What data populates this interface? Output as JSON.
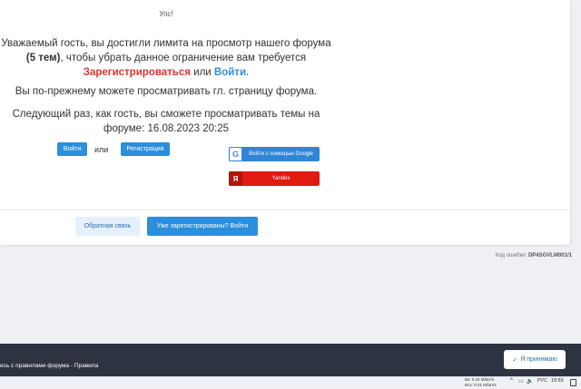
{
  "modal": {
    "title": "Упс!",
    "line1_a": "Уважаемый гость, вы достигли лимита на просмотр нашего форума ",
    "line1_count": "(5 тем)",
    "line1_b": ", чтобы убрать данное ограничение вам требуется ",
    "register_link": "Зарегистрироваться",
    "or_text": " или ",
    "login_link": "Войти",
    "line1_end": ".",
    "line2": "Вы по-прежнему можете просматривать гл. страницу форума.",
    "line3": "Следующий раз, как гость, вы сможете просматривать темы на форуме: 16.08.2023 20:25",
    "login_button": "Войти",
    "or_label": "или",
    "register_button": "Регистрация",
    "google_button": "Войти с помощью Google",
    "google_icon": "G",
    "yandex_button": "Yandex",
    "yandex_icon": "Я",
    "feedback_button": "Обратная связь",
    "already_registered_button": "Уже зарегистрированы? Войти"
  },
  "error": {
    "label": "Код ошибки:",
    "code": "DP4SGVLM001/1"
  },
  "cookie_bar": {
    "text": "есь с правилами форума - ",
    "rules_link": "Правила",
    "accept_check": "✓",
    "accept_label": "Я принимаю"
  },
  "taskbar": {
    "net_down_label": "Вх:",
    "net_down_value": "0.34 Мбит/s",
    "net_up_label": "Исх:",
    "net_up_value": "0.01 Мбит/s",
    "tray_up": "^",
    "tray_monitor": "▭",
    "tray_volume": "🔈",
    "language": "РУС",
    "time": "19:55"
  }
}
